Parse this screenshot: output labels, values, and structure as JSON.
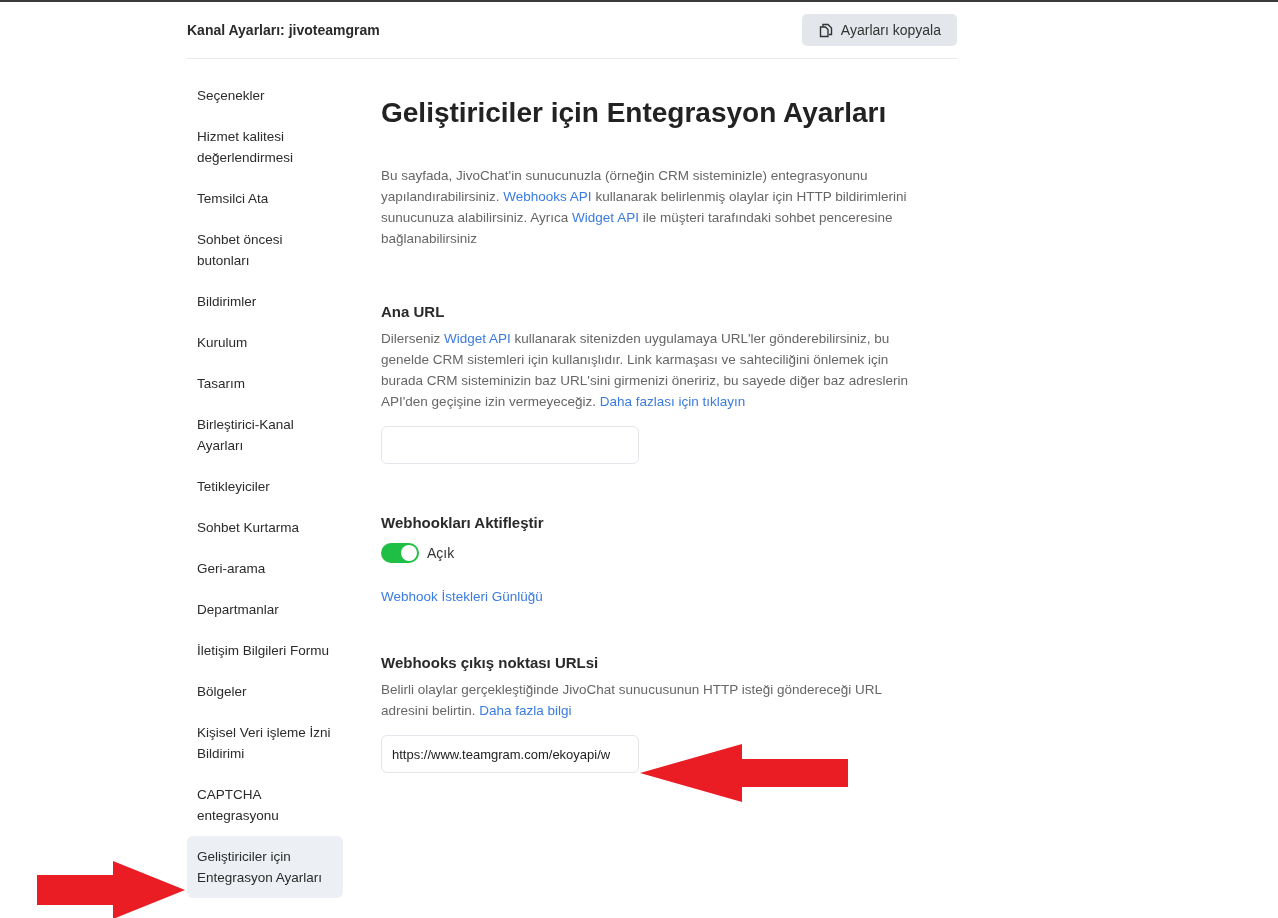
{
  "header": {
    "title": "Kanal Ayarları: jivoteamgram",
    "copy_button": "Ayarları kopyala"
  },
  "sidebar": {
    "items": [
      {
        "label": "Seçenekler",
        "selected": false
      },
      {
        "label": "Hizmet kalitesi değerlendirmesi",
        "selected": false
      },
      {
        "label": "Temsilci Ata",
        "selected": false
      },
      {
        "label": "Sohbet öncesi butonları",
        "selected": false
      },
      {
        "label": "Bildirimler",
        "selected": false
      },
      {
        "label": "Kurulum",
        "selected": false
      },
      {
        "label": "Tasarım",
        "selected": false
      },
      {
        "label": "Birleştirici-Kanal Ayarları",
        "selected": false
      },
      {
        "label": "Tetikleyiciler",
        "selected": false
      },
      {
        "label": "Sohbet Kurtarma",
        "selected": false
      },
      {
        "label": "Geri-arama",
        "selected": false
      },
      {
        "label": "Departmanlar",
        "selected": false
      },
      {
        "label": "İletişim Bilgileri Formu",
        "selected": false
      },
      {
        "label": "Bölgeler",
        "selected": false
      },
      {
        "label": "Kişisel Veri işleme İzni Bildirimi",
        "selected": false
      },
      {
        "label": "CAPTCHA entegrasyonu",
        "selected": false
      },
      {
        "label": "Geliştiriciler için Entegrasyon Ayarları",
        "selected": true
      }
    ]
  },
  "main": {
    "title": "Geliştiriciler için Entegrasyon Ayarları",
    "intro": [
      {
        "text": "Bu sayfada, JivoChat'in sunucunuzla (örneğin CRM sisteminizle) entegrasyonunu yapılandırabilirsiniz. "
      },
      {
        "link": "Webhooks API"
      },
      {
        "text": " kullanarak belirlenmiş olaylar için HTTP bildirimlerini sunucunuza alabilirsiniz. Ayrıca "
      },
      {
        "link": "Widget API"
      },
      {
        "text": " ile müşteri tarafındaki sohbet penceresine bağlanabilirsiniz"
      }
    ],
    "base_url": {
      "heading": "Ana URL",
      "description": [
        {
          "text": "Dilerseniz "
        },
        {
          "link": "Widget API"
        },
        {
          "text": " kullanarak sitenizden uygulamaya URL'ler gönderebilirsiniz, bu genelde CRM sistemleri için kullanışlıdır. Link karmaşası ve sahteciliğini önlemek için burada CRM sisteminizin baz URL'sini girmenizi öneririz, bu sayede diğer baz adreslerin API'den geçişine izin vermeyeceğiz. "
        },
        {
          "link": "Daha fazlası için tıklayın"
        }
      ]
    },
    "webhooks": {
      "heading": "Webhookları Aktifleştir",
      "toggle": {
        "on": true,
        "label": "Açık"
      },
      "log_link": "Webhook İstekleri Günlüğü"
    },
    "endpoint": {
      "heading": "Webhooks çıkış noktası URLsi",
      "description": [
        {
          "text": "Belirli olaylar gerçekleştiğinde JivoChat sunucusunun HTTP isteği göndereceği URL adresini belirtin. "
        },
        {
          "link": "Daha fazla bilgi"
        }
      ],
      "value": "https://www.teamgram.com/ekoyapi/w"
    }
  }
}
